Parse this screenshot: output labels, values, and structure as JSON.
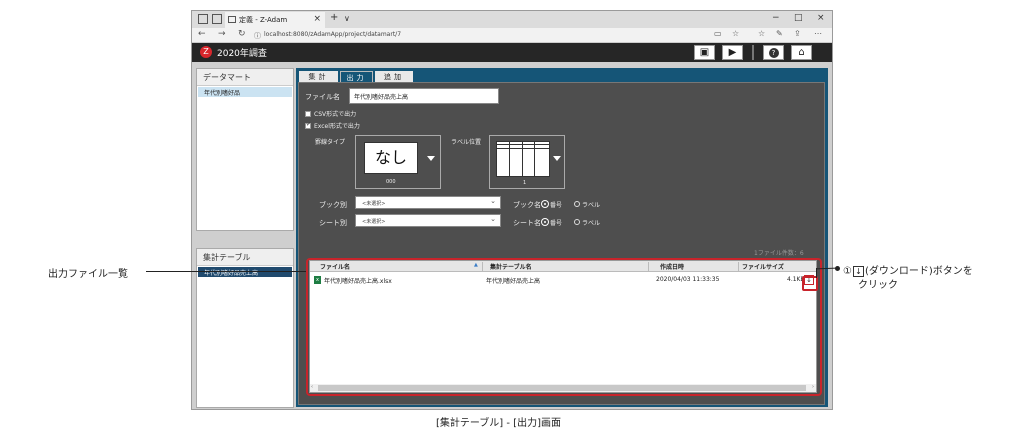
{
  "browser": {
    "tab_title": "定義 - Z-Adam",
    "tab_close": "×",
    "new_tab": "+",
    "tab_menu": "∨",
    "win_min": "−",
    "win_max": "□",
    "win_close": "×",
    "url": "localhost:8080/zAdamApp/project/datamart/7"
  },
  "app": {
    "title": "2020年調査"
  },
  "sidebar": {
    "datamart_title": "データマート",
    "datamart_items": [
      "年代別嗜好品"
    ],
    "table_title": "集計テーブル",
    "table_items": [
      "年代別嗜好品売上高"
    ]
  },
  "tabs": [
    "集計",
    "出力",
    "追加"
  ],
  "form": {
    "filename_label": "ファイル名",
    "filename_value": "年代別嗜好品売上高",
    "csv_label": "CSV形式で出力",
    "excel_label": "Excel形式で出力",
    "csv_checked": false,
    "excel_checked": true,
    "border_label": "罫線タイプ",
    "border_value": "なし",
    "border_code": "000",
    "label_pos_label": "ラベル位置",
    "label_pos_code": "1",
    "book_label": "ブック別",
    "sheet_label": "シート別",
    "book_select": "<未選択>",
    "sheet_select": "<未選択>",
    "book_name_label": "ブック名",
    "sheet_name_label": "シート名",
    "opt_number": "番号",
    "opt_label": "ラベル",
    "book_name_choice": "番号",
    "sheet_name_choice": "番号"
  },
  "file_list": {
    "count_text": "1ファイル件数：6",
    "columns": [
      "ファイル名",
      "集計テーブル名",
      "作成日時",
      "ファイルサイズ"
    ],
    "rows": [
      {
        "file": "年代別嗜好品売上高.xlsx",
        "table": "年代別嗜好品売上高",
        "created": "2020/04/03 11:33:35",
        "size": "4.1KB"
      }
    ]
  },
  "annotations": {
    "left_callout": "出力ファイル一覧",
    "right_callout_line1_prefix": "①",
    "right_callout_line1_suffix": "(ダウンロード)ボタンを",
    "right_callout_line2": "クリック",
    "caption": "[集計テーブル] - [出力]画面"
  },
  "colors": {
    "accent_red": "#c8242b",
    "app_header": "#262626",
    "main_frame": "#155577",
    "panel_bg": "#4e4e4e",
    "selected_item": "#cbe3f2"
  }
}
